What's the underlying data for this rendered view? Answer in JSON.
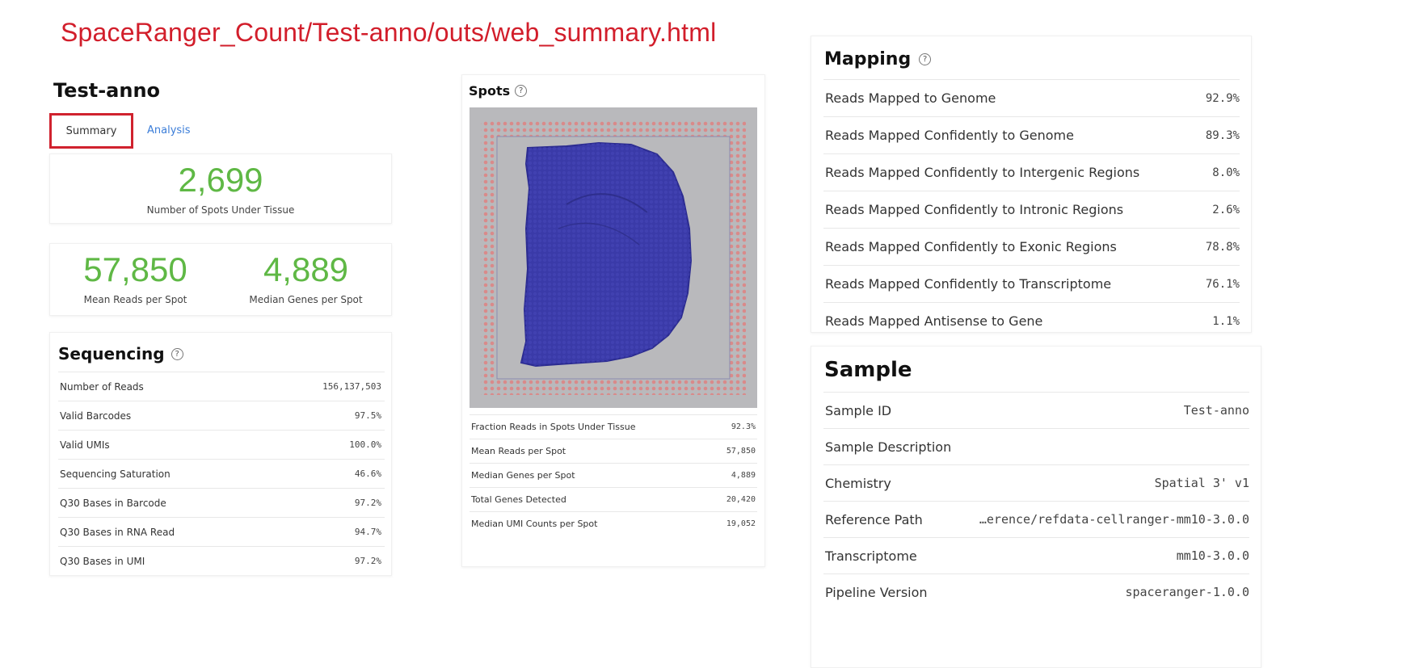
{
  "header": {
    "path": "SpaceRanger_Count/Test-anno/outs/web_summary.html"
  },
  "sample_name": "Test-anno",
  "tabs": {
    "summary": "Summary",
    "analysis": "Analysis"
  },
  "spots_under_tissue": {
    "value": "2,699",
    "label": "Number of Spots Under Tissue"
  },
  "reads_genes": {
    "mean_reads": {
      "value": "57,850",
      "label": "Mean Reads per Spot"
    },
    "median_genes": {
      "value": "4,889",
      "label": "Median Genes per Spot"
    }
  },
  "sequencing": {
    "title": "Sequencing",
    "rows": [
      {
        "label": "Number of Reads",
        "value": "156,137,503"
      },
      {
        "label": "Valid Barcodes",
        "value": "97.5%"
      },
      {
        "label": "Valid UMIs",
        "value": "100.0%"
      },
      {
        "label": "Sequencing Saturation",
        "value": "46.6%"
      },
      {
        "label": "Q30 Bases in Barcode",
        "value": "97.2%"
      },
      {
        "label": "Q30 Bases in RNA Read",
        "value": "94.7%"
      },
      {
        "label": "Q30 Bases in UMI",
        "value": "97.2%"
      }
    ]
  },
  "spots": {
    "title": "Spots",
    "rows": [
      {
        "label": "Fraction Reads in Spots Under Tissue",
        "value": "92.3%"
      },
      {
        "label": "Mean Reads per Spot",
        "value": "57,850"
      },
      {
        "label": "Median Genes per Spot",
        "value": "4,889"
      },
      {
        "label": "Total Genes Detected",
        "value": "20,420"
      },
      {
        "label": "Median UMI Counts per Spot",
        "value": "19,052"
      }
    ]
  },
  "mapping": {
    "title": "Mapping",
    "rows": [
      {
        "label": "Reads Mapped to Genome",
        "value": "92.9%"
      },
      {
        "label": "Reads Mapped Confidently to Genome",
        "value": "89.3%"
      },
      {
        "label": "Reads Mapped Confidently to Intergenic Regions",
        "value": "8.0%"
      },
      {
        "label": "Reads Mapped Confidently to Intronic Regions",
        "value": "2.6%"
      },
      {
        "label": "Reads Mapped Confidently to Exonic Regions",
        "value": "78.8%"
      },
      {
        "label": "Reads Mapped Confidently to Transcriptome",
        "value": "76.1%"
      },
      {
        "label": "Reads Mapped Antisense to Gene",
        "value": "1.1%"
      }
    ]
  },
  "sample": {
    "title": "Sample",
    "rows": [
      {
        "label": "Sample ID",
        "value": "Test-anno"
      },
      {
        "label": "Sample Description",
        "value": ""
      },
      {
        "label": "Chemistry",
        "value": "Spatial 3' v1"
      },
      {
        "label": "Reference Path",
        "value": "…erence/refdata-cellranger-mm10-3.0.0"
      },
      {
        "label": "Transcriptome",
        "value": "mm10-3.0.0"
      },
      {
        "label": "Pipeline Version",
        "value": "spaceranger-1.0.0"
      }
    ]
  },
  "icons": {
    "help": "help-circle-icon"
  },
  "colors": {
    "accent_red": "#d21e2b",
    "metric_green": "#5fb845",
    "link_blue": "#3b7dd8",
    "tissue_blue": "#3a3aa8",
    "fiducial_red": "#d98a8a"
  }
}
